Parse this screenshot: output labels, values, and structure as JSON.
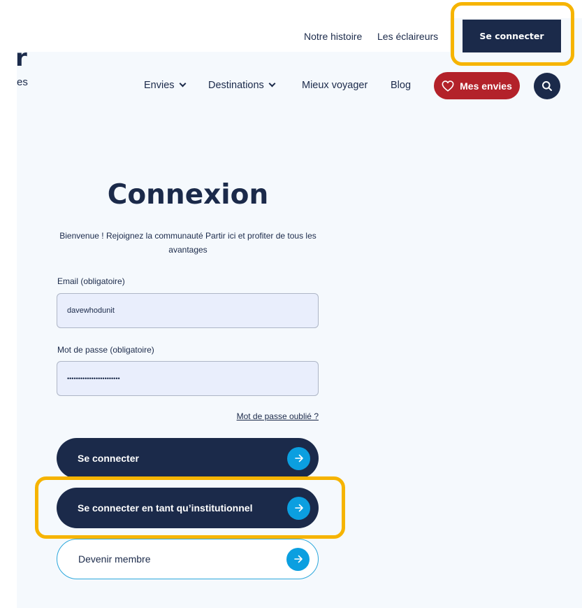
{
  "header": {
    "logo_letter": "r",
    "logo_subtext": "es",
    "top_links": [
      "Notre histoire",
      "Les éclaireurs"
    ],
    "connect_button": "Se connecter"
  },
  "nav": {
    "items": [
      {
        "label": "Envies",
        "has_dropdown": true
      },
      {
        "label": "Destinations",
        "has_dropdown": true
      },
      {
        "label": "Mieux voyager",
        "has_dropdown": false
      },
      {
        "label": "Blog",
        "has_dropdown": false
      }
    ],
    "wishlist_button": "Mes envies",
    "wishlist_icon": "heart-icon",
    "search_icon": "search-icon"
  },
  "login": {
    "title": "Connexion",
    "intro": "Bienvenue ! Rejoignez la communauté Partir ici et profiter de tous les avantages",
    "email_label": "Email (obligatoire)",
    "email_value": "davewhodunit",
    "password_label": "Mot de passe (obligatoire)",
    "password_value": "••••••••••••••••••••••••",
    "forgot_link": "Mot de passe oublié ?",
    "connect_button": "Se connecter",
    "institutional_button": "Se connecter en tant qu’institutionnel",
    "member_button": "Devenir membre",
    "arrow_icon": "arrow-right-icon"
  },
  "colors": {
    "navy": "#1b2a4a",
    "accent_red": "#b3222a",
    "accent_blue": "#0b9fe0",
    "highlight": "#f6b400",
    "page_bg": "#f5f9fd",
    "input_bg": "#e9eefc"
  }
}
